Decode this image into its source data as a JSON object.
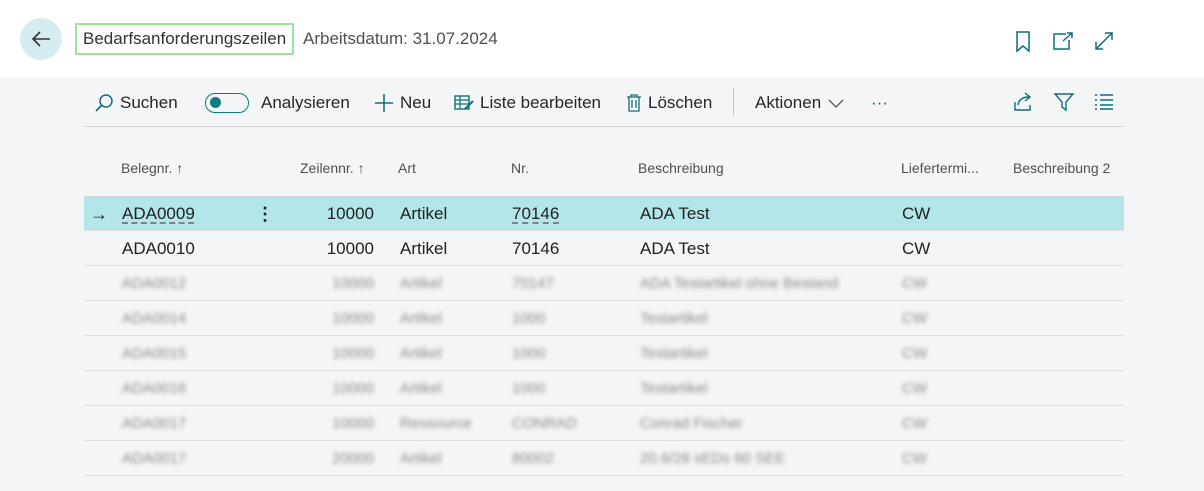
{
  "header": {
    "title": "Bedarfsanforderungszeilen",
    "workdate": "Arbeitsdatum: 31.07.2024"
  },
  "actions": {
    "search": "Suchen",
    "analyze": "Analysieren",
    "new": "Neu",
    "edit_list": "Liste bearbeiten",
    "delete": "Löschen",
    "more_actions": "Aktionen",
    "overflow": "···"
  },
  "columns": {
    "doc_no": "Belegnr.",
    "line_no": "Zeilennr.",
    "type": "Art",
    "no": "Nr.",
    "description": "Beschreibung",
    "delivery": "Liefertermi...",
    "description2": "Beschreibung 2"
  },
  "rows": [
    {
      "doc_no": "ADA0009",
      "line_no": "10000",
      "type": "Artikel",
      "no": "70146",
      "description": "ADA Test",
      "delivery": "CW"
    },
    {
      "doc_no": "ADA0010",
      "line_no": "10000",
      "type": "Artikel",
      "no": "70146",
      "description": "ADA Test",
      "delivery": "CW"
    },
    {
      "doc_no": "ADA0012",
      "line_no": "10000",
      "type": "Artikel",
      "no": "70147",
      "description": "ADA Testartikel ohne Bestand",
      "delivery": "CW"
    },
    {
      "doc_no": "ADA0014",
      "line_no": "10000",
      "type": "Artikel",
      "no": "1000",
      "description": "Testartikel",
      "delivery": "CW"
    },
    {
      "doc_no": "ADA0015",
      "line_no": "10000",
      "type": "Artikel",
      "no": "1000",
      "description": "Testartikel",
      "delivery": "CW"
    },
    {
      "doc_no": "ADA0016",
      "line_no": "10000",
      "type": "Artikel",
      "no": "1000",
      "description": "Testartikel",
      "delivery": "CW"
    },
    {
      "doc_no": "ADA0017",
      "line_no": "10000",
      "type": "Ressource",
      "no": "CONRAD",
      "description": "Conrad Fischer",
      "delivery": "CW"
    },
    {
      "doc_no": "ADA0017",
      "line_no": "20000",
      "type": "Artikel",
      "no": "80002",
      "description": "20.6/28 sEDs 60 SEE",
      "delivery": "CW"
    }
  ],
  "colors": {
    "accent": "#0e7a82",
    "selected_row": "#b2e6e9",
    "title_outline": "#9de39a"
  }
}
